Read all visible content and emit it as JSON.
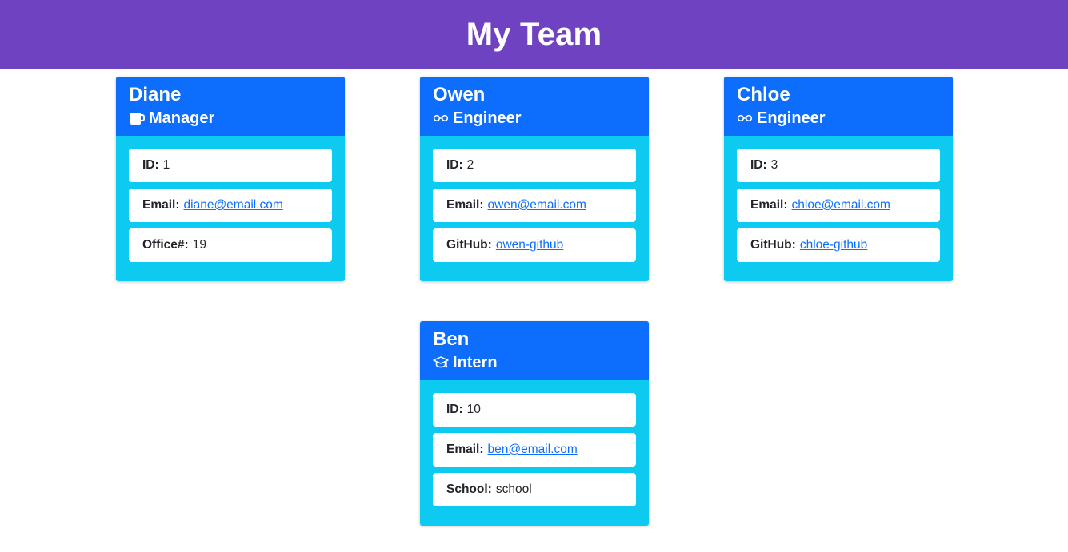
{
  "page": {
    "title": "My Team"
  },
  "colors": {
    "header_bg": "#6f42c1",
    "card_head_bg": "#0d6efd",
    "card_body_bg": "#0dcaf0",
    "link": "#0d6efd"
  },
  "team": {
    "diane": {
      "name": "Diane",
      "role": "Manager",
      "icon": "mug-icon",
      "id_label": "ID:",
      "id": "1",
      "email_label": "Email:",
      "email": "diane@email.com",
      "extra_label": "Office#:",
      "extra": "19"
    },
    "owen": {
      "name": "Owen",
      "role": "Engineer",
      "icon": "glasses-icon",
      "id_label": "ID:",
      "id": "2",
      "email_label": "Email:",
      "email": "owen@email.com",
      "extra_label": "GitHub:",
      "extra": "owen-github"
    },
    "chloe": {
      "name": "Chloe",
      "role": "Engineer",
      "icon": "glasses-icon",
      "id_label": "ID:",
      "id": "3",
      "email_label": "Email:",
      "email": "chloe@email.com",
      "extra_label": "GitHub:",
      "extra": "chloe-github"
    },
    "ben": {
      "name": "Ben",
      "role": "Intern",
      "icon": "graduation-cap-icon",
      "id_label": "ID:",
      "id": "10",
      "email_label": "Email:",
      "email": "ben@email.com",
      "extra_label": "School:",
      "extra": "school"
    }
  }
}
